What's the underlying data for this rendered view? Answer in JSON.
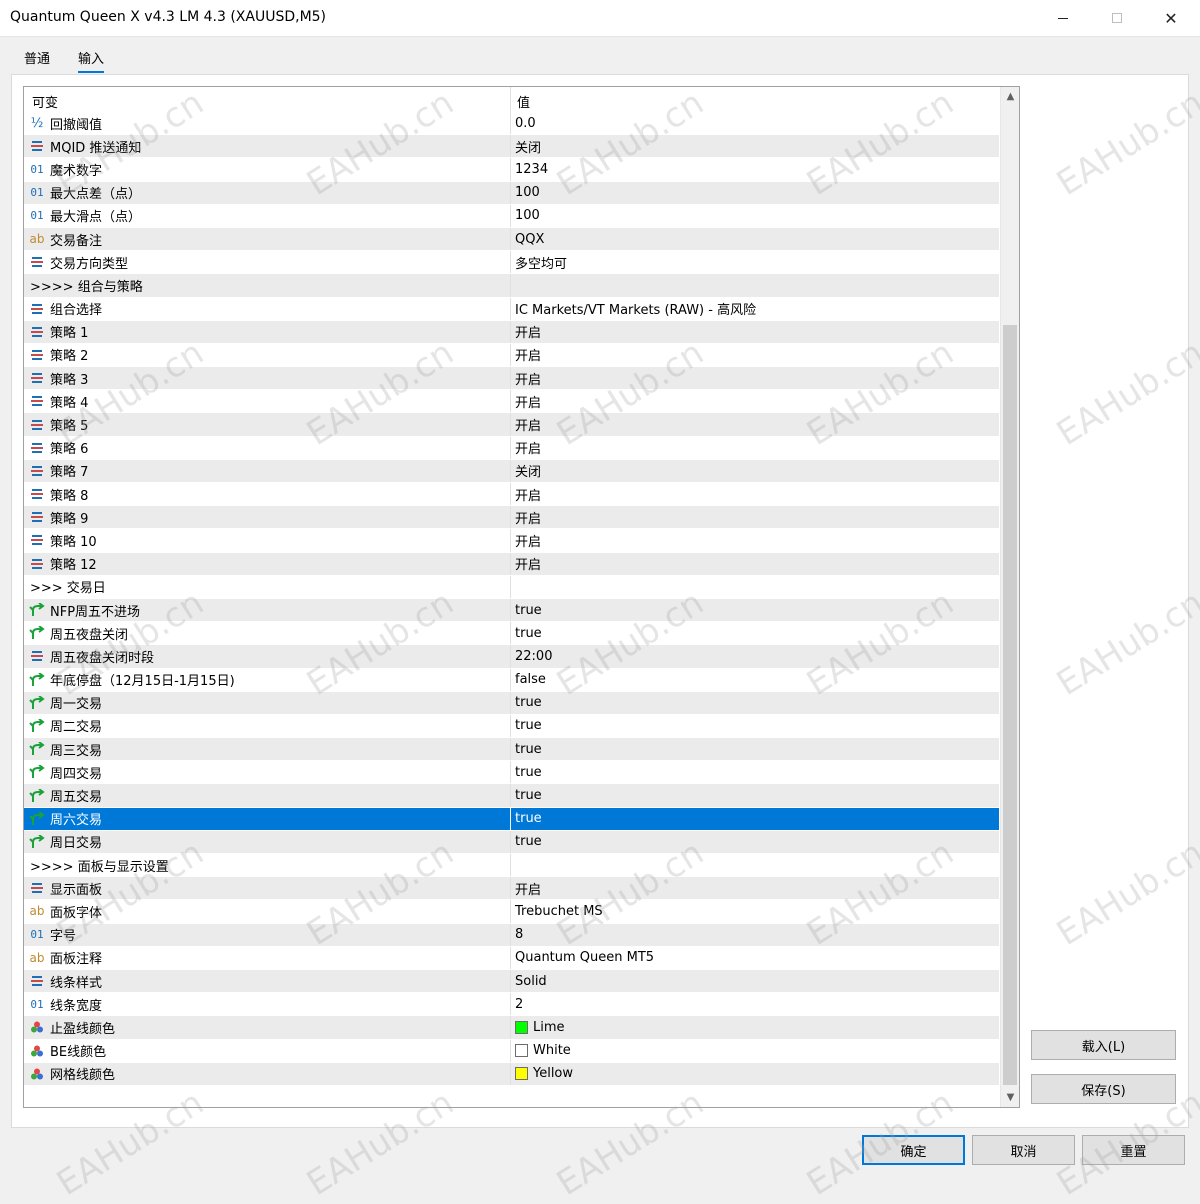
{
  "window": {
    "title": "Quantum Queen X v4.3 LM 4.3 (XAUUSD,M5)",
    "minimize_glyph": "—",
    "maximize_glyph": "☐",
    "close_glyph": "✕"
  },
  "tabs": [
    {
      "label": "普通",
      "active": false
    },
    {
      "label": "输入",
      "active": true
    }
  ],
  "grid": {
    "header": {
      "name": "可变",
      "value": "值"
    },
    "rows": [
      {
        "icon": "double-icon",
        "name": "回撤阈值",
        "value": "0.0"
      },
      {
        "icon": "enum-icon",
        "name": "MQID 推送通知",
        "value": "关闭"
      },
      {
        "icon": "int-icon",
        "name": "魔术数字",
        "value": "1234"
      },
      {
        "icon": "int-icon",
        "name": "最大点差（点）",
        "value": "100"
      },
      {
        "icon": "int-icon",
        "name": "最大滑点（点）",
        "value": "100"
      },
      {
        "icon": "string-icon",
        "name": "交易备注",
        "value": "QQX"
      },
      {
        "icon": "enum-icon",
        "name": "交易方向类型",
        "value": "多空均可"
      },
      {
        "icon": "",
        "name": ">>>> 组合与策略",
        "value": ""
      },
      {
        "icon": "enum-icon",
        "name": "组合选择",
        "value": "IC Markets/VT Markets (RAW) - 高风险"
      },
      {
        "icon": "enum-icon",
        "name": "策略 1",
        "value": "开启"
      },
      {
        "icon": "enum-icon",
        "name": "策略 2",
        "value": "开启"
      },
      {
        "icon": "enum-icon",
        "name": "策略 3",
        "value": "开启"
      },
      {
        "icon": "enum-icon",
        "name": "策略 4",
        "value": "开启"
      },
      {
        "icon": "enum-icon",
        "name": "策略 5",
        "value": "开启"
      },
      {
        "icon": "enum-icon",
        "name": "策略 6",
        "value": "开启"
      },
      {
        "icon": "enum-icon",
        "name": "策略 7",
        "value": "关闭"
      },
      {
        "icon": "enum-icon",
        "name": "策略 8",
        "value": "开启"
      },
      {
        "icon": "enum-icon",
        "name": "策略 9",
        "value": "开启"
      },
      {
        "icon": "enum-icon",
        "name": "策略 10",
        "value": "开启"
      },
      {
        "icon": "enum-icon",
        "name": "策略 12",
        "value": "开启"
      },
      {
        "icon": "",
        "name": ">>> 交易日",
        "value": ""
      },
      {
        "icon": "bool-icon",
        "name": "NFP周五不进场",
        "value": "true"
      },
      {
        "icon": "bool-icon",
        "name": "周五夜盘关闭",
        "value": "true"
      },
      {
        "icon": "enum-icon",
        "name": "周五夜盘关闭时段",
        "value": "22:00"
      },
      {
        "icon": "bool-icon",
        "name": "年底停盘（12月15日-1月15日)",
        "value": "false"
      },
      {
        "icon": "bool-icon",
        "name": "周一交易",
        "value": "true"
      },
      {
        "icon": "bool-icon",
        "name": "周二交易",
        "value": "true"
      },
      {
        "icon": "bool-icon",
        "name": "周三交易",
        "value": "true"
      },
      {
        "icon": "bool-icon",
        "name": "周四交易",
        "value": "true"
      },
      {
        "icon": "bool-icon",
        "name": "周五交易",
        "value": "true"
      },
      {
        "icon": "bool-icon",
        "name": "周六交易",
        "value": "true",
        "selected": true
      },
      {
        "icon": "bool-icon",
        "name": "周日交易",
        "value": "true"
      },
      {
        "icon": "",
        "name": ">>>> 面板与显示设置",
        "value": ""
      },
      {
        "icon": "enum-icon",
        "name": "显示面板",
        "value": "开启"
      },
      {
        "icon": "string-icon",
        "name": "面板字体",
        "value": "Trebuchet MS"
      },
      {
        "icon": "int-icon",
        "name": "字号",
        "value": "8"
      },
      {
        "icon": "string-icon",
        "name": "面板注释",
        "value": "Quantum Queen MT5"
      },
      {
        "icon": "enum-icon",
        "name": "线条样式",
        "value": "Solid"
      },
      {
        "icon": "int-icon",
        "name": "线条宽度",
        "value": "2"
      },
      {
        "icon": "color-icon",
        "name": "止盈线颜色",
        "value": "Lime",
        "swatch": "#00ff00"
      },
      {
        "icon": "color-icon",
        "name": "BE线颜色",
        "value": "White",
        "swatch": "#ffffff"
      },
      {
        "icon": "color-icon",
        "name": "网格线颜色",
        "value": "Yellow",
        "swatch": "#ffff00"
      }
    ]
  },
  "side_buttons": {
    "load": "载入(L)",
    "save": "保存(S)"
  },
  "footer_buttons": {
    "ok": "确定",
    "cancel": "取消",
    "reset": "重置"
  },
  "watermark": {
    "text": "EAHub.cn"
  },
  "colors": {
    "accent": "#0078d7",
    "row_alt": "#ebebeb",
    "bool_icon": "#1aa33a"
  }
}
